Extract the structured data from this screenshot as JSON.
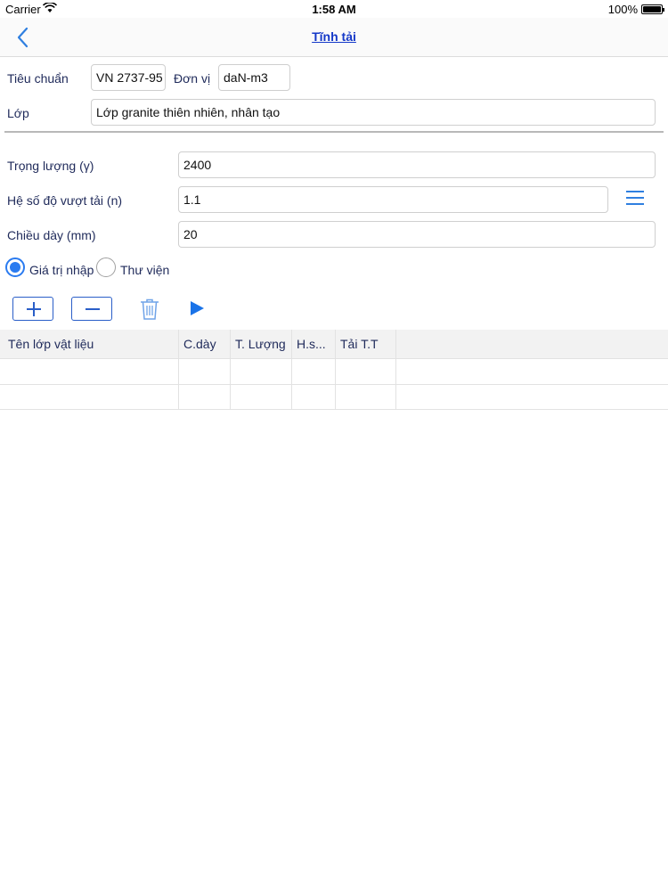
{
  "status_bar": {
    "carrier": "Carrier",
    "wifi_icon": "wifi-icon",
    "time": "1:58 AM",
    "battery_pct": "100%"
  },
  "nav": {
    "back_icon": "chevron-left-icon",
    "title": "Tĩnh tải"
  },
  "form": {
    "standard_label": "Tiêu chuẩn",
    "standard_value": "VN 2737-95",
    "unit_label": "Đơn vị",
    "unit_value": "daN-m3",
    "layer_label": "Lớp",
    "layer_value": "Lớp granite thiên nhiên, nhân tạo",
    "weight_label": "Trọng lượng (γ)",
    "weight_value": "2400",
    "overload_label": "Hệ số độ vượt tải (n)",
    "overload_value": "1.1",
    "thickness_label": "Chiều dày (mm)",
    "thickness_value": "20"
  },
  "options": {
    "input_value_label": "Giá trị nhập",
    "library_label": "Thư viện",
    "selected": "input_value"
  },
  "table": {
    "headers": [
      "Tên lớp vật liệu",
      "C.dày",
      "T. Lượng",
      "H.s...",
      "Tải T.T"
    ],
    "rows": [
      [
        "",
        "",
        "",
        "",
        ""
      ],
      [
        "",
        "",
        "",
        "",
        ""
      ]
    ]
  },
  "colors": {
    "accent": "#2a7bf0",
    "title": "#1438c8",
    "label": "#1f2a5a"
  }
}
